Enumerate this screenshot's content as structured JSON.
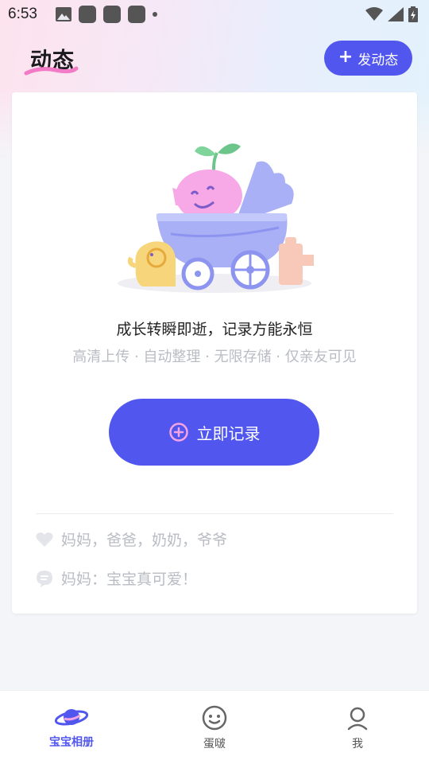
{
  "status_bar": {
    "time": "6:53"
  },
  "header": {
    "title": "动态",
    "post_button_label": "发动态"
  },
  "card": {
    "slogan": "成长转瞬即逝，记录方能永恒",
    "features": "高清上传 · 自动整理 · 无限存储 · 仅亲友可见",
    "record_button_label": "立即记录",
    "likes": "妈妈，爸爸，奶奶，爷爷",
    "comment": "妈妈：宝宝真可爱！"
  },
  "bottom_nav": {
    "items": [
      {
        "label": "宝宝相册",
        "icon": "planet-icon",
        "active": true
      },
      {
        "label": "蛋啵",
        "icon": "smiley-face-icon",
        "active": false
      },
      {
        "label": "我",
        "icon": "person-icon",
        "active": false
      }
    ]
  },
  "colors": {
    "accent": "#5157ee",
    "muted_text": "#b9bcc3"
  }
}
